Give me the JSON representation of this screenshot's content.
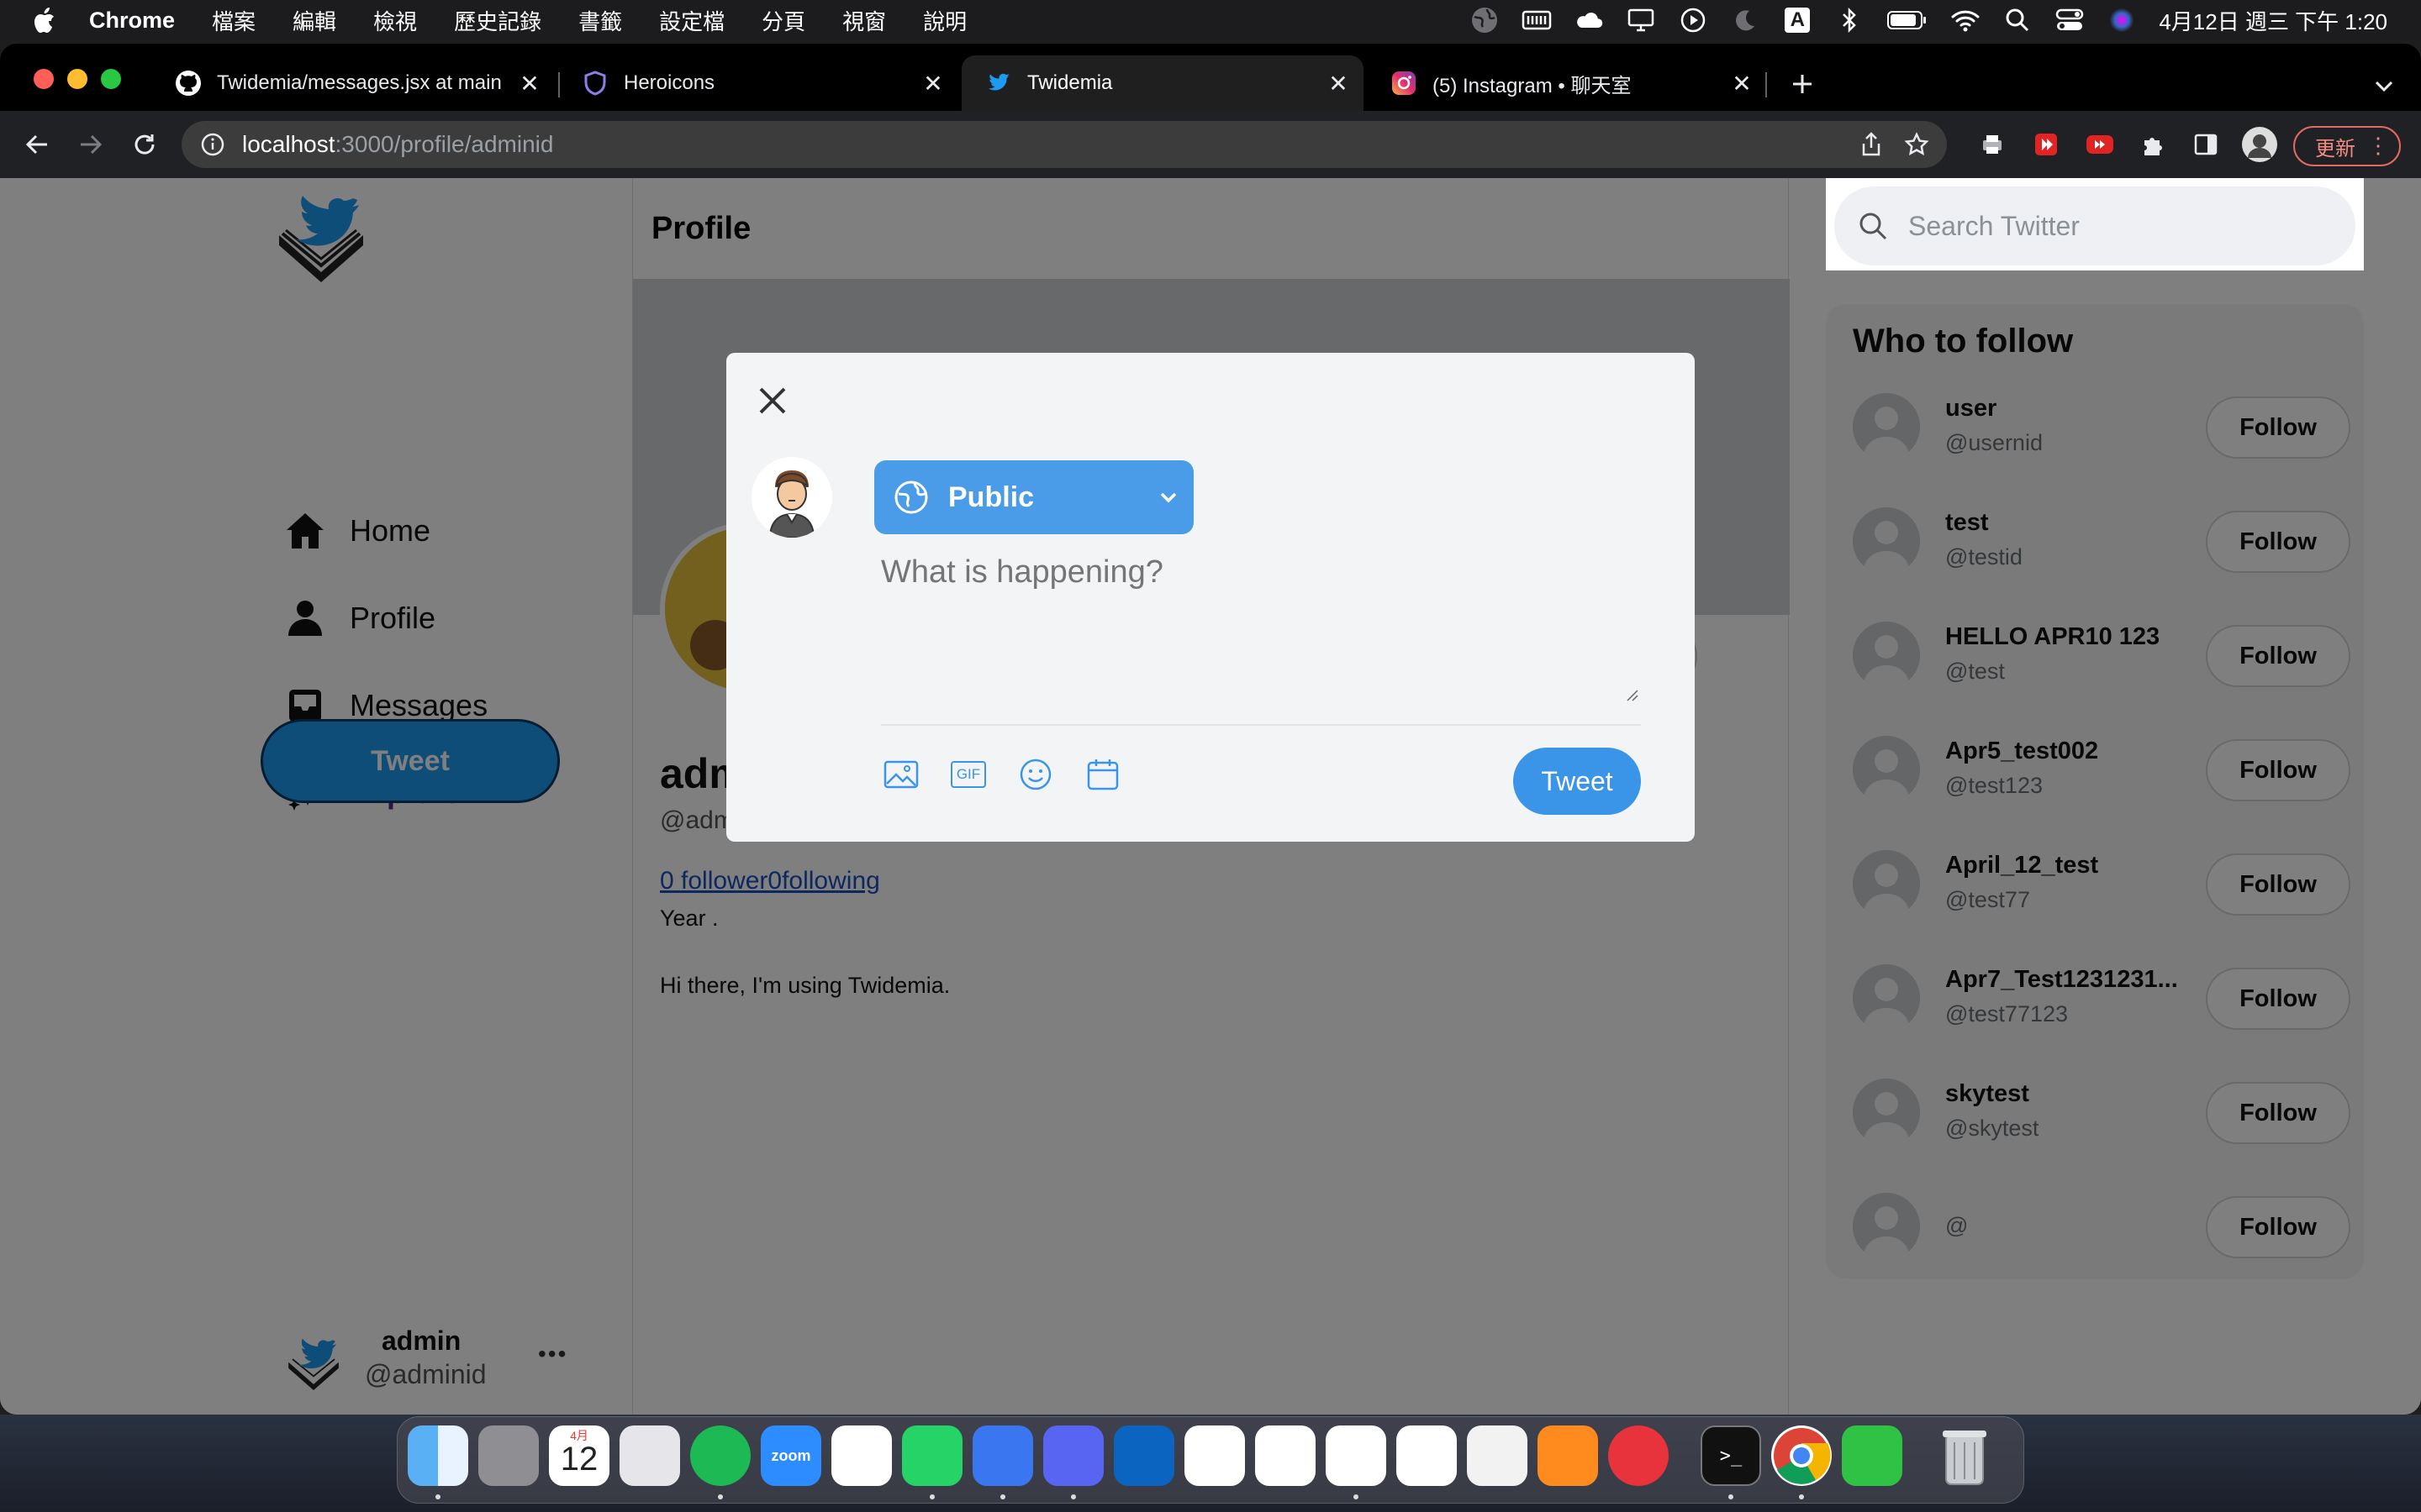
{
  "menubar": {
    "app": "Chrome",
    "menus": [
      "檔案",
      "編輯",
      "檢視",
      "歷史記錄",
      "書籤",
      "設定檔",
      "分頁",
      "視窗",
      "說明"
    ],
    "clock": "4月12日 週三 下午 1:20",
    "status_icons": [
      "globe-icon",
      "keyboard-icon",
      "cloud-icon",
      "display-icon",
      "play-icon",
      "moon-icon",
      "input-a-icon",
      "bluetooth-icon",
      "battery-icon",
      "wifi-icon",
      "search-icon",
      "control-center-icon",
      "siri-icon"
    ],
    "input_label": "A"
  },
  "browser": {
    "tabs": [
      {
        "title": "Twidemia/messages.jsx at main",
        "icon": "github-icon"
      },
      {
        "title": "Heroicons",
        "icon": "shield-icon"
      },
      {
        "title": "Twidemia",
        "icon": "twitter-icon"
      },
      {
        "title": "(5) Instagram • 聊天室",
        "icon": "instagram-icon"
      }
    ],
    "url_host": "localhost",
    "url_rest": ":3000/profile/adminid",
    "update_label": "更新"
  },
  "app": {
    "nav": [
      {
        "label": "Home",
        "icon": "home-icon"
      },
      {
        "label": "Profile",
        "icon": "user-icon"
      },
      {
        "label": "Messages",
        "icon": "inbox-icon"
      },
      {
        "label": "Explore",
        "icon": "sparkles-icon"
      }
    ],
    "tweet_button": "Tweet",
    "account": {
      "name": "admin",
      "handle": "@adminid",
      "more": "•••"
    },
    "header_title": "Profile",
    "profile": {
      "name": "admin",
      "handle": "@adminid",
      "follow_text": "0 follower0following",
      "year": "Year .",
      "bio": "Hi there, I'm using Twidemia.",
      "edit_button_fragment": "e"
    },
    "search_placeholder": "Search Twitter",
    "who_to_follow": {
      "title": "Who to follow",
      "follow_label": "Follow",
      "users": [
        {
          "name": "user",
          "handle": "@usernid"
        },
        {
          "name": "test",
          "handle": "@testid"
        },
        {
          "name": "HELLO APR10 123",
          "handle": "@test"
        },
        {
          "name": "Apr5_test002",
          "handle": "@test123"
        },
        {
          "name": "April_12_test",
          "handle": "@test77"
        },
        {
          "name": "Apr7_Test1231231...",
          "handle": "@test77123"
        },
        {
          "name": "skytest",
          "handle": "@skytest"
        },
        {
          "name": "",
          "handle": "@"
        }
      ]
    }
  },
  "modal": {
    "visibility": "Public",
    "placeholder": "What is happening?",
    "tweet_button": "Tweet",
    "tools": [
      "image-icon",
      "gif-icon",
      "emoji-icon",
      "calendar-icon"
    ],
    "gif_label": "GIF"
  },
  "dock": {
    "calendar_month": "4月",
    "calendar_day": "12",
    "apps": [
      "finder",
      "system-settings",
      "calendar",
      "launchpad",
      "spotify",
      "zoom",
      "photos",
      "whatsapp",
      "signal",
      "discord",
      "outlook",
      "powerpoint",
      "word",
      "vscode",
      "slack",
      "textedit",
      "pencil",
      "fist-app",
      "terminal",
      "chrome",
      "facetime",
      "trash"
    ],
    "zoom_label": "zoom"
  },
  "colors": {
    "accent": "#1d9bf0",
    "explore": "#5b2a86",
    "visibility_button": "#4a9be8"
  }
}
